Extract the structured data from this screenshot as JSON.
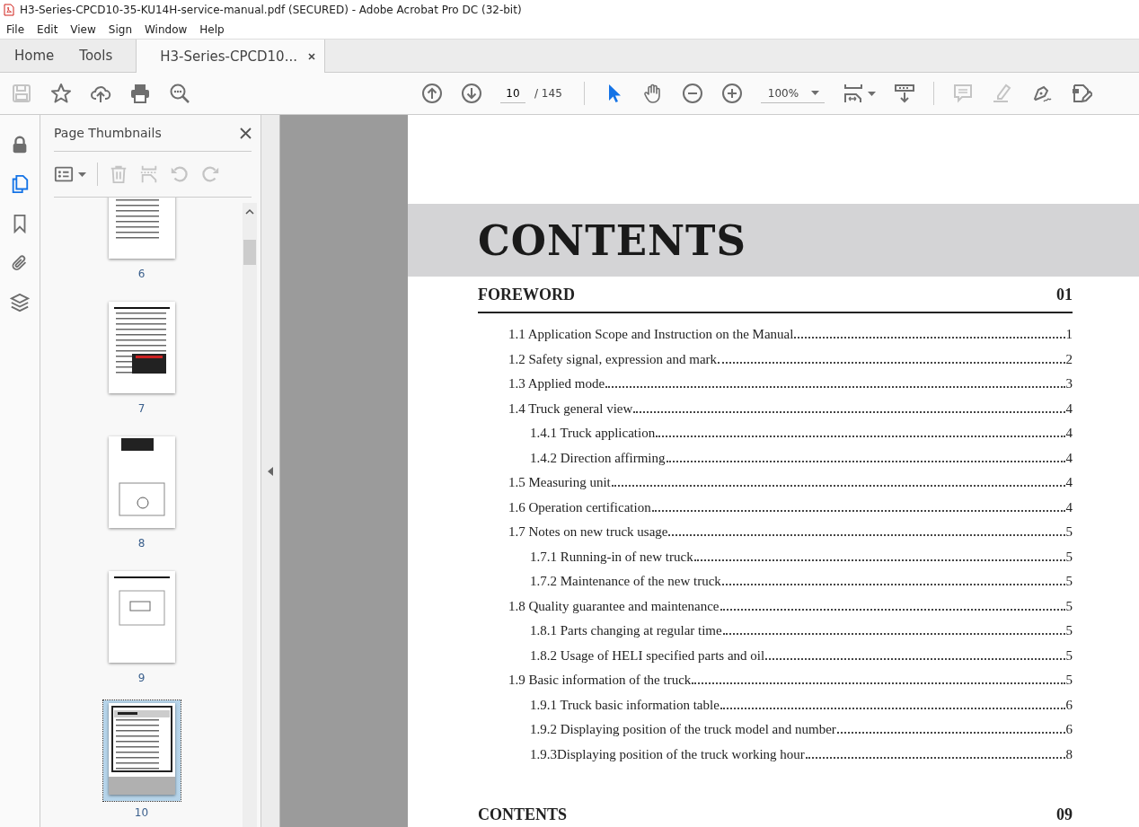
{
  "window": {
    "title": "H3-Series-CPCD10-35-KU14H-service-manual.pdf (SECURED) - Adobe Acrobat Pro DC (32-bit)"
  },
  "menu": [
    "File",
    "Edit",
    "View",
    "Sign",
    "Window",
    "Help"
  ],
  "tabs": [
    {
      "label": "Home",
      "selected": false
    },
    {
      "label": "Tools",
      "selected": false
    },
    {
      "label": "H3-Series-CPCD10...",
      "selected": true
    }
  ],
  "toolbar": {
    "left_tools": [
      {
        "kind": "save",
        "disabled": true
      },
      {
        "kind": "star",
        "disabled": false
      },
      {
        "kind": "upload",
        "disabled": false
      },
      {
        "kind": "print",
        "disabled": false
      },
      {
        "kind": "find",
        "disabled": false
      }
    ],
    "page_field": {
      "value": "10"
    },
    "page_total": "/ 145",
    "view_tools": [
      {
        "kind": "select",
        "selected": true
      },
      {
        "kind": "hand",
        "selected": false
      },
      {
        "kind": "zoom-out",
        "selected": false
      },
      {
        "kind": "zoom-in",
        "selected": false
      }
    ],
    "zoom": {
      "value": "100%"
    },
    "right_tools": [
      {
        "kind": "comment",
        "disabled": true
      },
      {
        "kind": "highlight",
        "disabled": true
      },
      {
        "kind": "sign",
        "disabled": false
      },
      {
        "kind": "edit",
        "disabled": false
      }
    ]
  },
  "rail": [
    {
      "kind": "lock",
      "selected": false
    },
    {
      "kind": "pages",
      "selected": true
    },
    {
      "kind": "bookmark",
      "selected": false
    },
    {
      "kind": "attachment",
      "selected": false
    },
    {
      "kind": "layers",
      "selected": false
    }
  ],
  "sidebar": {
    "title": "Page Thumbnails",
    "tools": [
      {
        "kind": "delete",
        "disabled": true
      },
      {
        "kind": "extract",
        "disabled": true
      },
      {
        "kind": "rotate-left",
        "disabled": true
      },
      {
        "kind": "rotate-right",
        "disabled": true
      }
    ],
    "thumbnails": [
      {
        "label": "6",
        "selected": false
      },
      {
        "label": "7",
        "selected": false
      },
      {
        "label": "8",
        "selected": false
      },
      {
        "label": "9",
        "selected": false
      },
      {
        "label": "10",
        "selected": true
      }
    ]
  },
  "document": {
    "heading": "CONTENTS",
    "sections": [
      {
        "title": "FOREWORD",
        "number": "01",
        "entries": [
          {
            "label": "1.1 Application Scope and Instruction on the Manual",
            "page": "1"
          },
          {
            "label": "1.2 Safety signal, expression and mark",
            "page": "2"
          },
          {
            "label": "1.3 Applied mode",
            "page": "3"
          },
          {
            "label": "1.4 Truck general view",
            "page": "4",
            "children": [
              {
                "label": "1.4.1 Truck application",
                "page": "4"
              },
              {
                "label": "1.4.2 Direction affirming",
                "page": "4"
              }
            ]
          },
          {
            "label": "1.5 Measuring unit",
            "page": "4"
          },
          {
            "label": "1.6 Operation certification",
            "page": "4"
          },
          {
            "label": "1.7 Notes on new truck usage",
            "page": "5",
            "children": [
              {
                "label": "1.7.1 Running-in of new truck",
                "page": "5"
              },
              {
                "label": "1.7.2 Maintenance of the new truck",
                "page": "5"
              }
            ]
          },
          {
            "label": "1.8 Quality guarantee and maintenance",
            "page": "5",
            "children": [
              {
                "label": "1.8.1 Parts changing at regular time",
                "page": "5"
              },
              {
                "label": "1.8.2 Usage of HELI specified parts and oil",
                "page": "5"
              }
            ]
          },
          {
            "label": "1.9 Basic information of the truck",
            "page": "5",
            "children": [
              {
                "label": "1.9.1 Truck basic information table",
                "page": "6"
              },
              {
                "label": "1.9.2 Displaying position of the truck model and number",
                "page": "6"
              },
              {
                "label": "1.9.3Displaying position of the truck working hour",
                "page": "8"
              }
            ]
          }
        ]
      },
      {
        "title": "CONTENTS",
        "number": "09"
      }
    ]
  }
}
